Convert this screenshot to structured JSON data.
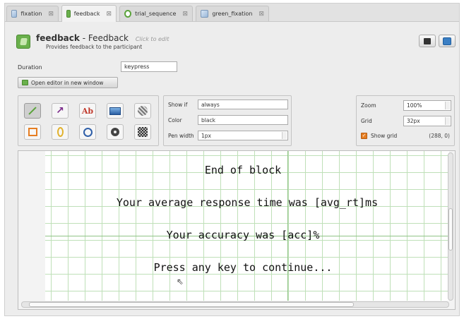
{
  "tabs": [
    {
      "label": "fixation",
      "icon": "sketchpad-icon",
      "active": false
    },
    {
      "label": "feedback",
      "icon": "feedback-icon",
      "active": true
    },
    {
      "label": "trial_sequence",
      "icon": "sequence-icon",
      "active": false
    },
    {
      "label": "green_fixation",
      "icon": "sketchpad-icon",
      "active": false
    }
  ],
  "header": {
    "name": "feedback",
    "separator": " - ",
    "type": "Feedback",
    "hint": "Click to edit",
    "description": "Provides feedback to the participant"
  },
  "duration": {
    "label": "Duration",
    "value": "keypress"
  },
  "open_editor_label": "Open editor in new window",
  "tools": [
    "line-tool",
    "arrow-tool",
    "text-tool",
    "image-tool",
    "gabor-tool",
    "rect-tool",
    "ellipse-tool",
    "circle-tool",
    "fixdot-tool",
    "noise-patch-tool"
  ],
  "tool_text_label": "Ab",
  "props": {
    "show_if_label": "Show if",
    "show_if_value": "always",
    "color_label": "Color",
    "color_value": "black",
    "pen_width_label": "Pen width",
    "pen_width_value": "1px"
  },
  "zoom": {
    "zoom_label": "Zoom",
    "zoom_value": "100%",
    "grid_label": "Grid",
    "grid_value": "32px",
    "show_grid_label": "Show grid",
    "show_grid_checked": true,
    "coords": "(288, 0)"
  },
  "canvas": {
    "lines": [
      "End of block",
      "Your average response time was [avg_rt]ms",
      "Your accuracy was [acc]%",
      "Press any key to continue..."
    ]
  },
  "colors": {
    "accent_green": "#6ab04c",
    "grid": "#bfe0b8",
    "checkbox": "#e67e22"
  }
}
